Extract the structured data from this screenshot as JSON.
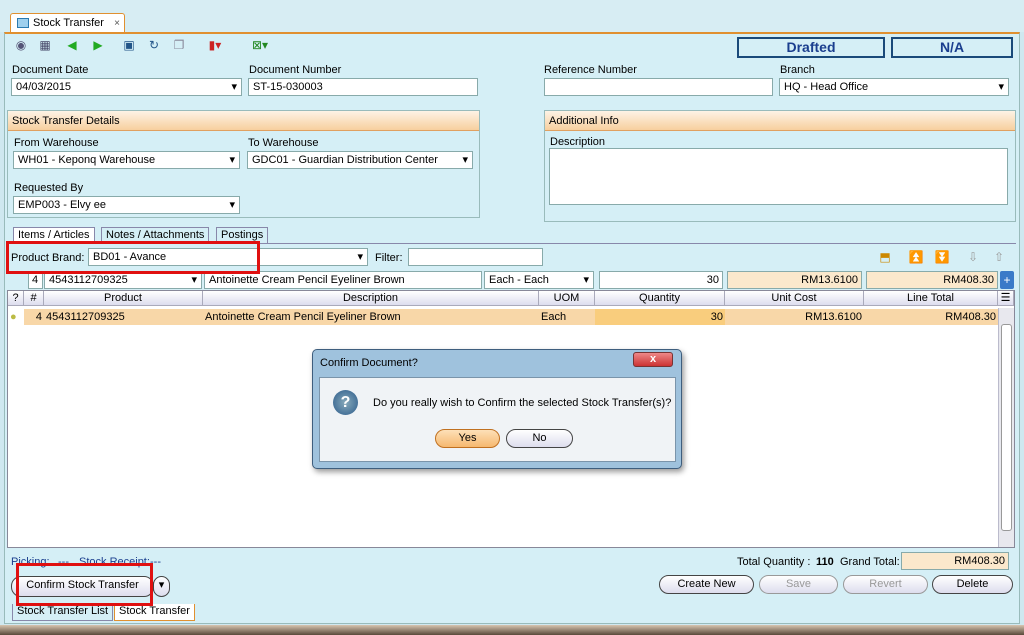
{
  "tab": {
    "title": "Stock Transfer",
    "close": "×"
  },
  "status": {
    "state": "Drafted",
    "value": "N/A"
  },
  "header": {
    "document_date_label": "Document Date",
    "document_date": "04/03/2015",
    "document_number_label": "Document Number",
    "document_number": "ST-15-030003",
    "reference_number_label": "Reference Number",
    "reference_number": "",
    "branch_label": "Branch",
    "branch": "HQ - Head Office"
  },
  "details": {
    "title": "Stock Transfer Details",
    "from_label": "From Warehouse",
    "from": "WH01 - Keponq Warehouse",
    "to_label": "To Warehouse",
    "to": "GDC01 - Guardian Distribution Center",
    "requested_label": "Requested By",
    "requested": "EMP003 - Elvy ee"
  },
  "additional": {
    "title": "Additional Info",
    "description_label": "Description",
    "description": ""
  },
  "subtabs": [
    "Items / Articles",
    "Notes / Attachments",
    "Postings"
  ],
  "filter": {
    "brand_label": "Product Brand:",
    "brand": "BD01 - Avance",
    "filter_label": "Filter:",
    "filter_value": ""
  },
  "entry": {
    "seq": "4",
    "product": "4543112709325",
    "description": "Antoinette Cream Pencil Eyeliner Brown",
    "uom": "Each - Each",
    "quantity": "30",
    "unit_cost": "RM13.6100",
    "line_total": "RM408.30"
  },
  "grid": {
    "columns": [
      "?",
      "#",
      "Product",
      "Description",
      "UOM",
      "Quantity",
      "Unit Cost",
      "Line Total"
    ],
    "rows": [
      {
        "no": "4",
        "product": "4543112709325",
        "description": "Antoinette Cream Pencil Eyeliner Brown",
        "uom": "Each",
        "quantity": "30",
        "unit_cost": "RM13.6100",
        "line_total": "RM408.30"
      }
    ]
  },
  "footer": {
    "picking_label": "Picking:",
    "picking": "---",
    "receipt_label": "Stock Receipt:",
    "receipt": "---",
    "total_qty_label": "Total Quantity :",
    "total_qty": "110",
    "grand_total_label": "Grand Total:",
    "grand_total": "RM408.30"
  },
  "actions": {
    "confirm": "Confirm Stock Transfer",
    "create_new": "Create New",
    "save": "Save",
    "revert": "Revert",
    "delete": "Delete"
  },
  "bottom_tabs": [
    "Stock Transfer List",
    "Stock Transfer"
  ],
  "dialog": {
    "title": "Confirm Document?",
    "message": "Do you really wish to Confirm the selected Stock Transfer(s)?",
    "yes": "Yes",
    "no": "No",
    "close": "x"
  },
  "colors": {
    "accent": "#e09030",
    "panel": "#d5eff6",
    "highlight": "#f8d7a8",
    "red": "#e01010"
  }
}
